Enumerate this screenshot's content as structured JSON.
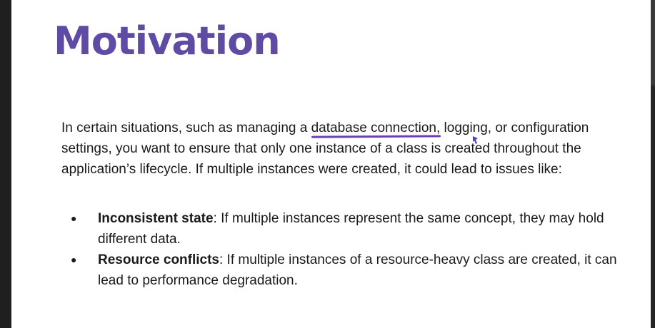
{
  "slide": {
    "title": "Motivation",
    "paragraph": {
      "before": "In certain situations, such as managing a ",
      "highlighted": "database connection",
      "after": ", logging, or configuration settings, you want to ensure that only one instance of a class is created throughout the application’s lifecycle. If multiple instances were created, it could lead to issues like:"
    },
    "bullets": [
      {
        "term": "Inconsistent state",
        "text": ": If multiple instances represent the same concept, they may hold different data."
      },
      {
        "term": "Resource conflicts",
        "text": ": If multiple instances of a resource-heavy class are created, it can lead to performance degradation."
      }
    ]
  },
  "colors": {
    "title": "#5f4ba3",
    "underline": "#6b3fb8",
    "text": "#1a1a1a",
    "sidebar": "#1f1f1f"
  },
  "icons": {
    "cursor": "pen-cursor-icon",
    "bullet": "bullet-dot-icon"
  }
}
